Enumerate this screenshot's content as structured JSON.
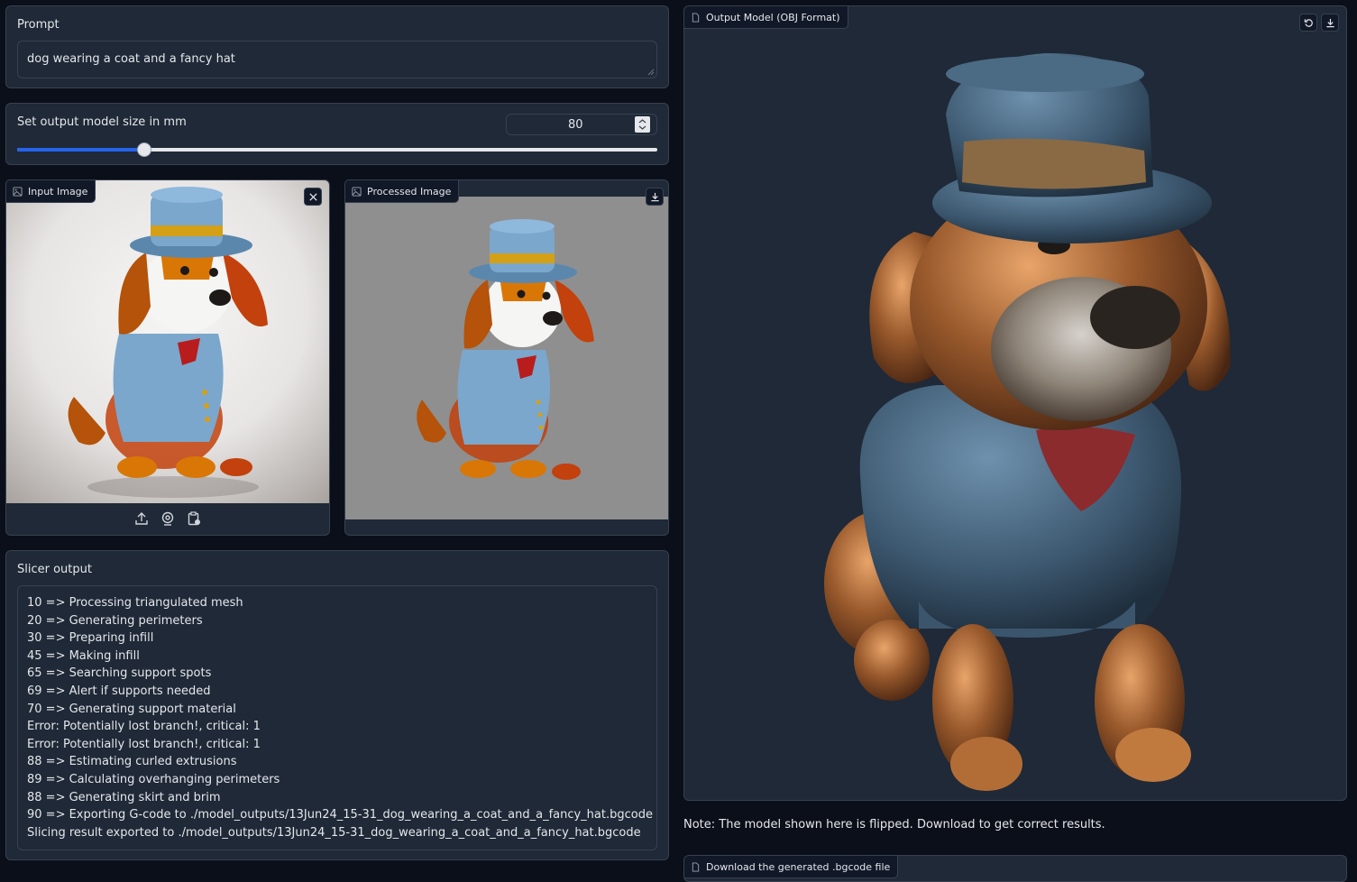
{
  "prompt": {
    "label": "Prompt",
    "value": "dog wearing a coat and a fancy hat"
  },
  "size": {
    "label": "Set output model size in mm",
    "value": "80",
    "slider_fraction": 0.198
  },
  "input_image": {
    "label": "Input Image",
    "icons": [
      "image-icon",
      "close-icon",
      "upload-icon",
      "webcam-icon",
      "clipboard-icon"
    ]
  },
  "processed_image": {
    "label": "Processed Image",
    "icons": [
      "image-icon",
      "download-icon"
    ]
  },
  "output_model": {
    "label": "Output Model (OBJ Format)",
    "icons": [
      "file-icon",
      "reset-icon",
      "download-icon"
    ]
  },
  "note": "Note: The model shown here is flipped. Download to get correct results.",
  "bottom_panel_label": "Download the generated .bgcode file",
  "slicer": {
    "label": "Slicer output",
    "lines": [
      "10 => Processing triangulated mesh",
      "20 => Generating perimeters",
      "30 => Preparing infill",
      "45 => Making infill",
      "65 => Searching support spots",
      "69 => Alert if supports needed",
      "70 => Generating support material",
      "Error: Potentially lost branch!, critical: 1",
      "Error: Potentially lost branch!, critical: 1",
      "88 => Estimating curled extrusions",
      "89 => Calculating overhanging perimeters",
      "88 => Generating skirt and brim",
      "90 => Exporting G-code to ./model_outputs/13Jun24_15-31_dog_wearing_a_coat_and_a_fancy_hat.bgcode",
      "Slicing result exported to ./model_outputs/13Jun24_15-31_dog_wearing_a_coat_and_a_fancy_hat.bgcode"
    ]
  },
  "colors": {
    "accent": "#2563eb",
    "panel": "#1f2937",
    "border": "#374151",
    "page": "#0b0f19"
  }
}
